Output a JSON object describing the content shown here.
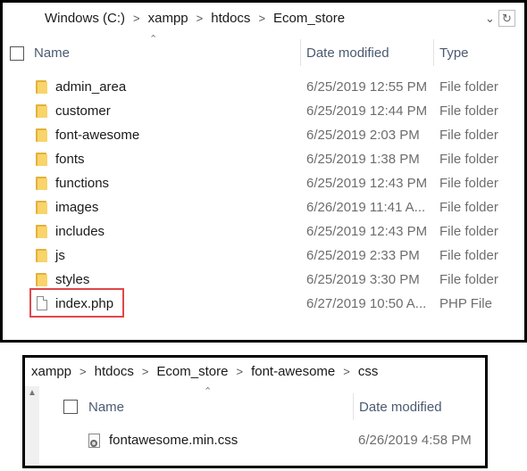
{
  "top_window": {
    "breadcrumb": [
      "Windows (C:)",
      "xampp",
      "htdocs",
      "Ecom_store"
    ],
    "breadcrumb_separator": ">",
    "dropdown_icon": "chevron-down",
    "refresh_icon": "refresh",
    "columns": {
      "name": "Name",
      "date": "Date modified",
      "type": "Type"
    },
    "items": [
      {
        "name": "admin_area",
        "date": "6/25/2019 12:55 PM",
        "type": "File folder",
        "icon": "folder"
      },
      {
        "name": "customer",
        "date": "6/25/2019 12:44 PM",
        "type": "File folder",
        "icon": "folder"
      },
      {
        "name": "font-awesome",
        "date": "6/25/2019 2:03 PM",
        "type": "File folder",
        "icon": "folder"
      },
      {
        "name": "fonts",
        "date": "6/25/2019 1:38 PM",
        "type": "File folder",
        "icon": "folder"
      },
      {
        "name": "functions",
        "date": "6/25/2019 12:43 PM",
        "type": "File folder",
        "icon": "folder"
      },
      {
        "name": "images",
        "date": "6/26/2019 11:41 A...",
        "type": "File folder",
        "icon": "folder"
      },
      {
        "name": "includes",
        "date": "6/25/2019 12:43 PM",
        "type": "File folder",
        "icon": "folder"
      },
      {
        "name": "js",
        "date": "6/25/2019 2:33 PM",
        "type": "File folder",
        "icon": "folder"
      },
      {
        "name": "styles",
        "date": "6/25/2019 3:30 PM",
        "type": "File folder",
        "icon": "folder"
      },
      {
        "name": "index.php",
        "date": "6/27/2019 10:50 A...",
        "type": "PHP File",
        "icon": "file",
        "highlighted": true
      }
    ]
  },
  "bottom_window": {
    "breadcrumb": [
      "xampp",
      "htdocs",
      "Ecom_store",
      "font-awesome",
      "css"
    ],
    "breadcrumb_separator": ">",
    "columns": {
      "name": "Name",
      "date": "Date modified"
    },
    "items": [
      {
        "name": "fontawesome.min.css",
        "date": "6/26/2019 4:58 PM",
        "icon": "css-file"
      }
    ]
  },
  "colors": {
    "folder": "#f8d46a",
    "highlight_border": "#e0474b",
    "header_text": "#4a5a70"
  }
}
